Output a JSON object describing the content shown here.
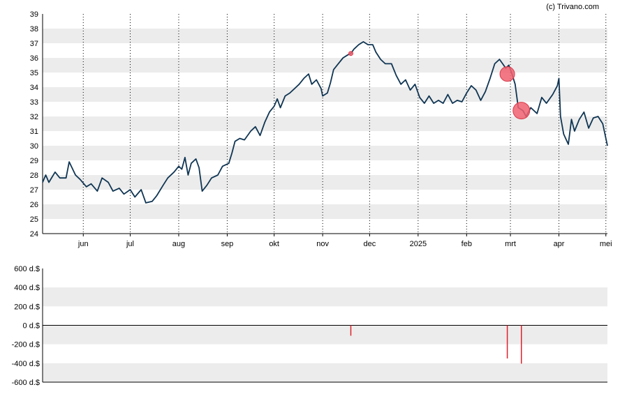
{
  "credit": "(c) Trivano.com",
  "colors": {
    "price_line": "#0f3553",
    "band": "#ececec",
    "grid_dotted": "#000000",
    "axis": "#000000",
    "bubble_fill": "#f06070",
    "bubble_stroke": "#d93a4a",
    "bar": "#e0202a"
  },
  "chart_data": [
    {
      "type": "line",
      "title": "",
      "xlabel": "",
      "ylabel": "",
      "ylim": [
        24,
        39
      ],
      "yticks": [
        24,
        25,
        26,
        27,
        28,
        29,
        30,
        31,
        32,
        33,
        34,
        35,
        36,
        37,
        38,
        39
      ],
      "month_labels": [
        "jun",
        "jul",
        "aug",
        "sep",
        "okt",
        "nov",
        "dec",
        "2025",
        "feb",
        "mrt",
        "apr",
        "mei"
      ],
      "x_domain": [
        "2024-05-06",
        "2025-05-02"
      ],
      "grid": "horizontal alternating bands, vertical dotted lines at month starts",
      "series": [
        {
          "points": [
            [
              "2024-05-06",
              27.5
            ],
            [
              "2024-05-08",
              28.0
            ],
            [
              "2024-05-10",
              27.5
            ],
            [
              "2024-05-14",
              28.2
            ],
            [
              "2024-05-17",
              27.8
            ],
            [
              "2024-05-21",
              27.8
            ],
            [
              "2024-05-23",
              28.9
            ],
            [
              "2024-05-27",
              28.0
            ],
            [
              "2024-05-30",
              27.7
            ],
            [
              "2024-06-03",
              27.2
            ],
            [
              "2024-06-06",
              27.4
            ],
            [
              "2024-06-10",
              26.9
            ],
            [
              "2024-06-13",
              27.8
            ],
            [
              "2024-06-17",
              27.5
            ],
            [
              "2024-06-20",
              26.9
            ],
            [
              "2024-06-24",
              27.1
            ],
            [
              "2024-06-27",
              26.7
            ],
            [
              "2024-07-01",
              27.0
            ],
            [
              "2024-07-04",
              26.5
            ],
            [
              "2024-07-08",
              27.0
            ],
            [
              "2024-07-11",
              26.1
            ],
            [
              "2024-07-15",
              26.2
            ],
            [
              "2024-07-18",
              26.6
            ],
            [
              "2024-07-22",
              27.3
            ],
            [
              "2024-07-25",
              27.8
            ],
            [
              "2024-07-29",
              28.2
            ],
            [
              "2024-08-01",
              28.6
            ],
            [
              "2024-08-03",
              28.4
            ],
            [
              "2024-08-05",
              29.2
            ],
            [
              "2024-08-07",
              28.0
            ],
            [
              "2024-08-09",
              28.8
            ],
            [
              "2024-08-12",
              29.1
            ],
            [
              "2024-08-14",
              28.5
            ],
            [
              "2024-08-16",
              26.9
            ],
            [
              "2024-08-19",
              27.3
            ],
            [
              "2024-08-22",
              27.8
            ],
            [
              "2024-08-26",
              28.0
            ],
            [
              "2024-08-29",
              28.6
            ],
            [
              "2024-09-02",
              28.8
            ],
            [
              "2024-09-04",
              29.5
            ],
            [
              "2024-09-06",
              30.3
            ],
            [
              "2024-09-09",
              30.5
            ],
            [
              "2024-09-12",
              30.4
            ],
            [
              "2024-09-16",
              31.0
            ],
            [
              "2024-09-19",
              31.3
            ],
            [
              "2024-09-22",
              30.7
            ],
            [
              "2024-09-25",
              31.6
            ],
            [
              "2024-09-28",
              32.3
            ],
            [
              "2024-10-01",
              32.7
            ],
            [
              "2024-10-03",
              33.2
            ],
            [
              "2024-10-05",
              32.6
            ],
            [
              "2024-10-08",
              33.4
            ],
            [
              "2024-10-11",
              33.6
            ],
            [
              "2024-10-14",
              33.9
            ],
            [
              "2024-10-17",
              34.2
            ],
            [
              "2024-10-20",
              34.6
            ],
            [
              "2024-10-23",
              34.9
            ],
            [
              "2024-10-25",
              34.2
            ],
            [
              "2024-10-28",
              34.5
            ],
            [
              "2024-10-31",
              33.9
            ],
            [
              "2024-11-01",
              33.4
            ],
            [
              "2024-11-04",
              33.6
            ],
            [
              "2024-11-06",
              34.3
            ],
            [
              "2024-11-08",
              35.2
            ],
            [
              "2024-11-11",
              35.6
            ],
            [
              "2024-11-14",
              36.0
            ],
            [
              "2024-11-17",
              36.2
            ],
            [
              "2024-11-19",
              36.3
            ],
            [
              "2024-11-21",
              36.6
            ],
            [
              "2024-11-24",
              36.9
            ],
            [
              "2024-11-27",
              37.1
            ],
            [
              "2024-11-30",
              36.9
            ],
            [
              "2024-12-03",
              36.9
            ],
            [
              "2024-12-05",
              36.4
            ],
            [
              "2024-12-08",
              35.9
            ],
            [
              "2024-12-11",
              35.6
            ],
            [
              "2024-12-15",
              35.6
            ],
            [
              "2024-12-18",
              34.8
            ],
            [
              "2024-12-21",
              34.2
            ],
            [
              "2024-12-24",
              34.5
            ],
            [
              "2024-12-27",
              33.8
            ],
            [
              "2024-12-30",
              34.2
            ],
            [
              "2025-01-02",
              33.3
            ],
            [
              "2025-01-05",
              32.9
            ],
            [
              "2025-01-08",
              33.4
            ],
            [
              "2025-01-11",
              32.9
            ],
            [
              "2025-01-14",
              33.1
            ],
            [
              "2025-01-17",
              32.9
            ],
            [
              "2025-01-20",
              33.5
            ],
            [
              "2025-01-23",
              32.9
            ],
            [
              "2025-01-26",
              33.1
            ],
            [
              "2025-01-29",
              33.0
            ],
            [
              "2025-02-01",
              33.6
            ],
            [
              "2025-02-04",
              34.1
            ],
            [
              "2025-02-07",
              33.8
            ],
            [
              "2025-02-10",
              33.1
            ],
            [
              "2025-02-13",
              33.7
            ],
            [
              "2025-02-16",
              34.6
            ],
            [
              "2025-02-19",
              35.6
            ],
            [
              "2025-02-22",
              35.9
            ],
            [
              "2025-02-24",
              35.6
            ],
            [
              "2025-02-26",
              35.3
            ],
            [
              "2025-02-28",
              35.5
            ],
            [
              "2025-03-02",
              34.9
            ],
            [
              "2025-03-04",
              34.2
            ],
            [
              "2025-03-06",
              32.6
            ],
            [
              "2025-03-09",
              32.4
            ],
            [
              "2025-03-11",
              32.0
            ],
            [
              "2025-03-14",
              32.6
            ],
            [
              "2025-03-18",
              32.2
            ],
            [
              "2025-03-21",
              33.3
            ],
            [
              "2025-03-24",
              32.9
            ],
            [
              "2025-03-28",
              33.5
            ],
            [
              "2025-03-31",
              34.1
            ],
            [
              "2025-04-01",
              34.6
            ],
            [
              "2025-04-02",
              32.0
            ],
            [
              "2025-04-04",
              30.8
            ],
            [
              "2025-04-07",
              30.1
            ],
            [
              "2025-04-09",
              31.8
            ],
            [
              "2025-04-11",
              31.0
            ],
            [
              "2025-04-14",
              31.8
            ],
            [
              "2025-04-17",
              32.3
            ],
            [
              "2025-04-20",
              31.2
            ],
            [
              "2025-04-23",
              31.9
            ],
            [
              "2025-04-26",
              32.0
            ],
            [
              "2025-04-29",
              31.5
            ],
            [
              "2025-05-02",
              30.0
            ]
          ]
        }
      ],
      "markers": [
        {
          "date": "2024-11-19",
          "value": 36.3,
          "size": 1
        },
        {
          "date": "2025-02-27",
          "value": 34.9,
          "size": 3.5
        },
        {
          "date": "2025-03-08",
          "value": 32.4,
          "size": 4
        }
      ]
    },
    {
      "type": "bar",
      "title": "",
      "ylim": [
        -600,
        600
      ],
      "yticks": [
        600,
        400,
        200,
        0,
        -200,
        -400,
        -600
      ],
      "ytick_labels": [
        "600 d.$",
        "400 d.$",
        "200 d.$",
        "0 d.$",
        "-200 d.$",
        "-400 d.$",
        "-600 d.$"
      ],
      "bars": [
        {
          "date": "2024-11-19",
          "value": -110
        },
        {
          "date": "2025-02-27",
          "value": -350
        },
        {
          "date": "2025-03-08",
          "value": -405
        }
      ]
    }
  ]
}
